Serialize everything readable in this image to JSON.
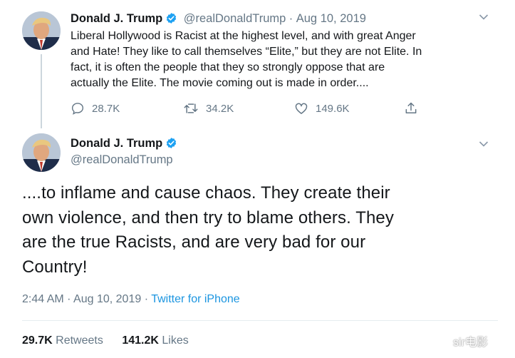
{
  "tweet1": {
    "name": "Donald J. Trump",
    "handle": "@realDonaldTrump",
    "separator": "·",
    "date": "Aug 10, 2019",
    "text_lines": [
      "Liberal Hollywood is Racist at the highest level, and with great Anger",
      "and Hate! They like to call themselves “Elite,” but they are not Elite. In",
      "fact, it is often the people that they so strongly oppose that are",
      "actually the Elite. The movie coming out is made in order...."
    ],
    "replies": "28.7K",
    "retweets": "34.2K",
    "likes": "149.6K"
  },
  "tweet2": {
    "name": "Donald J. Trump",
    "handle": "@realDonaldTrump",
    "text_lines": [
      "....to inflame and cause chaos. They create their",
      "own violence, and then try to blame others. They",
      "are the true Racists, and are very bad for our",
      "Country!"
    ],
    "time": "2:44 AM",
    "date": "Aug 10, 2019",
    "separator": "·",
    "source": "Twitter for iPhone",
    "retweet_count": "29.7K",
    "retweet_label": "Retweets",
    "like_count": "141.2K",
    "like_label": "Likes"
  },
  "watermark": "sir电影",
  "icons": [
    "verified-icon",
    "chevron-down-icon",
    "reply-icon",
    "retweet-icon",
    "like-icon",
    "share-icon"
  ],
  "colors": {
    "verified": "#1da1f2",
    "link": "#1b95e0",
    "muted": "#657786"
  }
}
